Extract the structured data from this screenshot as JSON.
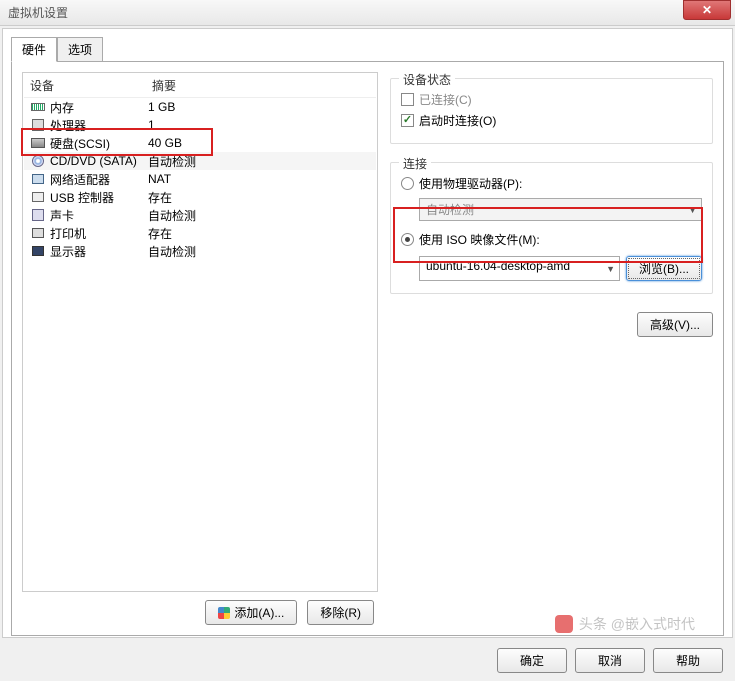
{
  "title": "虚拟机设置",
  "tabs": {
    "hardware": "硬件",
    "options": "选项"
  },
  "headers": {
    "device": "设备",
    "summary": "摘要"
  },
  "hardware": [
    {
      "icon": "mem-icon",
      "name": "内存",
      "summary": "1 GB"
    },
    {
      "icon": "cpu-icon",
      "name": "处理器",
      "summary": "1"
    },
    {
      "icon": "hdd-icon",
      "name": "硬盘(SCSI)",
      "summary": "40 GB"
    },
    {
      "icon": "cd-icon",
      "name": "CD/DVD (SATA)",
      "summary": "自动检测"
    },
    {
      "icon": "net-icon",
      "name": "网络适配器",
      "summary": "NAT"
    },
    {
      "icon": "usb-icon",
      "name": "USB 控制器",
      "summary": "存在"
    },
    {
      "icon": "snd-icon",
      "name": "声卡",
      "summary": "自动检测"
    },
    {
      "icon": "prn-icon",
      "name": "打印机",
      "summary": "存在"
    },
    {
      "icon": "disp-icon",
      "name": "显示器",
      "summary": "自动检测"
    }
  ],
  "buttons": {
    "add": "添加(A)...",
    "remove": "移除(R)",
    "browse": "浏览(B)...",
    "advanced": "高级(V)...",
    "ok": "确定",
    "cancel": "取消",
    "help": "帮助"
  },
  "groups": {
    "status": "设备状态",
    "connection": "连接"
  },
  "status": {
    "connected": "已连接(C)",
    "connect_on_power": "启动时连接(O)"
  },
  "connection": {
    "use_physical": "使用物理驱动器(P):",
    "physical_value": "自动检测",
    "use_iso": "使用 ISO 映像文件(M):",
    "iso_value": "ubuntu-16.04-desktop-amd"
  },
  "watermark": "头条 @嵌入式时代"
}
